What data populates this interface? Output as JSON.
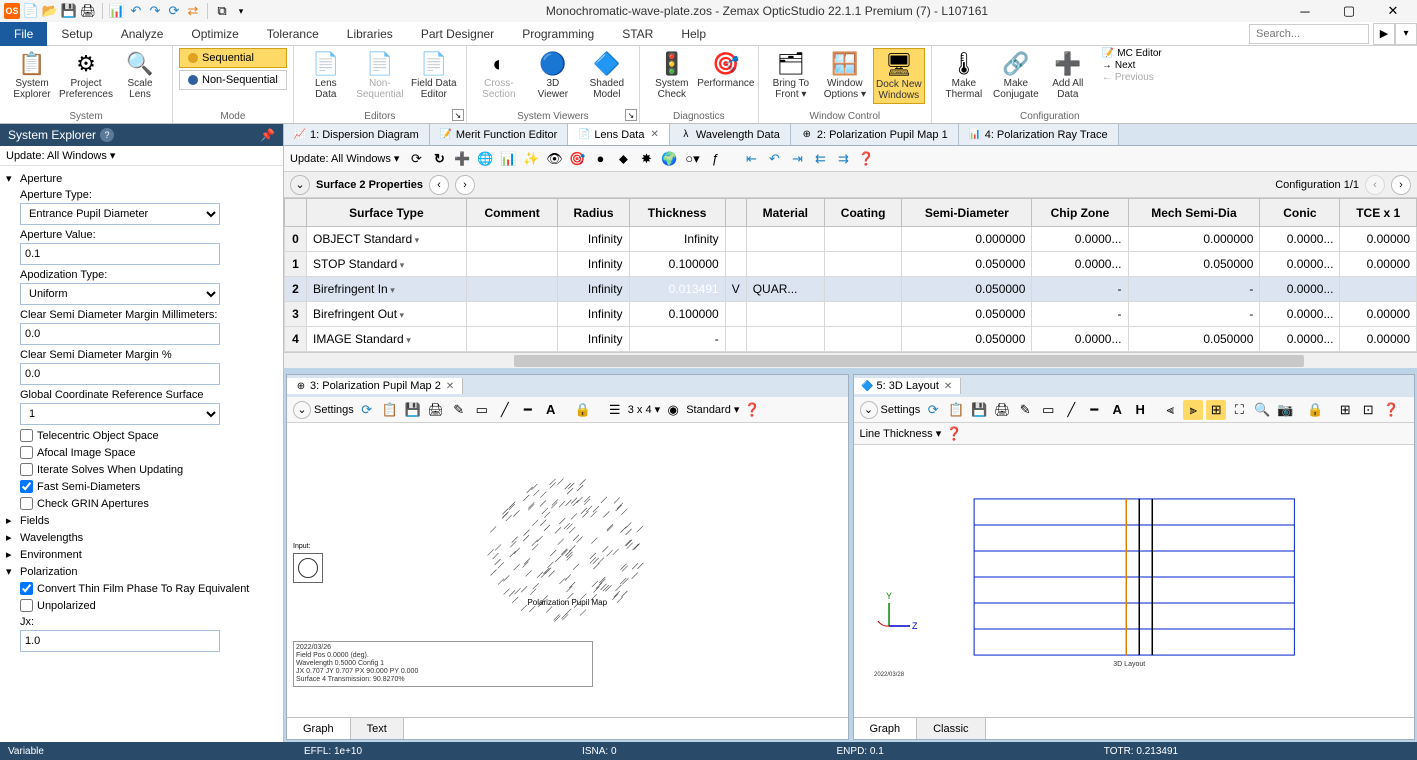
{
  "title": "Monochromatic-wave-plate.zos - Zemax OpticStudio 22.1.1  Premium (7) - L107161",
  "menu": [
    "Setup",
    "Analyze",
    "Optimize",
    "Tolerance",
    "Libraries",
    "Part Designer",
    "Programming",
    "STAR",
    "Help"
  ],
  "search_placeholder": "Search...",
  "ribbon": {
    "system": {
      "label": "System",
      "btns": [
        {
          "label": "System\nExplorer",
          "icon": "📋"
        },
        {
          "label": "Project\nPreferences",
          "icon": "⚙"
        },
        {
          "label": "Scale\nLens",
          "icon": "🔍"
        }
      ]
    },
    "mode": {
      "label": "Mode",
      "seq": "Sequential",
      "nonseq": "Non-Sequential"
    },
    "editors": {
      "label": "Editors",
      "btns": [
        {
          "label": "Lens\nData",
          "icon": "📄"
        },
        {
          "label": "Non-Sequential",
          "icon": "📄",
          "disabled": true
        },
        {
          "label": "Field Data\nEditor",
          "icon": "📄"
        }
      ]
    },
    "viewers": {
      "label": "System Viewers",
      "btns": [
        {
          "label": "Cross-Section",
          "icon": "◐",
          "disabled": true
        },
        {
          "label": "3D\nViewer",
          "icon": "🔵"
        },
        {
          "label": "Shaded\nModel",
          "icon": "🔷"
        }
      ]
    },
    "diag": {
      "label": "Diagnostics",
      "btns": [
        {
          "label": "System\nCheck",
          "icon": "🚦"
        },
        {
          "label": "Performance",
          "icon": "🎯"
        }
      ]
    },
    "windows": {
      "label": "Window Control",
      "btns": [
        {
          "label": "Bring To\nFront ▾",
          "icon": "🗂"
        },
        {
          "label": "Window\nOptions ▾",
          "icon": "🪟"
        },
        {
          "label": "Dock New\nWindows",
          "icon": "🖥",
          "active": true
        }
      ]
    },
    "config": {
      "label": "Configuration",
      "btns": [
        {
          "label": "Make\nThermal",
          "icon": "🌡"
        },
        {
          "label": "Make\nConjugate",
          "icon": "🔗"
        },
        {
          "label": "Add All\nData",
          "icon": "➕"
        }
      ],
      "side": [
        {
          "label": "MC Editor",
          "icon": "📝"
        },
        {
          "label": "Next",
          "icon": "→"
        },
        {
          "label": "Previous",
          "icon": "←",
          "disabled": true
        }
      ]
    }
  },
  "sidebar": {
    "title": "System Explorer",
    "update": "Update: All Windows ▾",
    "aperture": {
      "heading": "Aperture",
      "type_label": "Aperture Type:",
      "type_value": "Entrance Pupil Diameter",
      "value_label": "Aperture Value:",
      "value": "0.1",
      "apod_label": "Apodization Type:",
      "apod_value": "Uniform",
      "csdmm_label": "Clear Semi Diameter Margin Millimeters:",
      "csdmm_value": "0.0",
      "csdmp_label": "Clear Semi Diameter Margin %",
      "csdmp_value": "0.0",
      "gcrs_label": "Global Coordinate Reference Surface",
      "gcrs_value": "1",
      "checks": [
        {
          "label": "Telecentric Object Space",
          "checked": false
        },
        {
          "label": "Afocal Image Space",
          "checked": false
        },
        {
          "label": "Iterate Solves When Updating",
          "checked": false
        },
        {
          "label": "Fast Semi-Diameters",
          "checked": true
        },
        {
          "label": "Check GRIN Apertures",
          "checked": false
        }
      ]
    },
    "sections": [
      "Fields",
      "Wavelengths",
      "Environment",
      "Polarization"
    ],
    "polarization": {
      "checks": [
        {
          "label": "Convert Thin Film Phase To Ray Equivalent",
          "checked": true
        },
        {
          "label": "Unpolarized",
          "checked": false
        }
      ],
      "jx_label": "Jx:",
      "jx_value": "1.0"
    }
  },
  "tabs": [
    {
      "label": "1: Dispersion Diagram",
      "icon": "📈"
    },
    {
      "label": "Merit Function Editor",
      "icon": "📝"
    },
    {
      "label": "Lens Data",
      "icon": "📄",
      "active": true,
      "closable": true
    },
    {
      "label": "Wavelength Data",
      "icon": "λ"
    },
    {
      "label": "2: Polarization Pupil Map 1",
      "icon": "⊕"
    },
    {
      "label": "4: Polarization Ray Trace",
      "icon": "📊"
    }
  ],
  "lensdata": {
    "update": "Update: All Windows ▾",
    "surface_label": "Surface   2 Properties",
    "config_label": "Configuration 1/1",
    "headers": [
      "",
      "Surface Type",
      "Comment",
      "Radius",
      "Thickness",
      "",
      "Material",
      "Coating",
      "Semi-Diameter",
      "Chip Zone",
      "Mech Semi-Dia",
      "Conic",
      "TCE x 1"
    ],
    "rows": [
      {
        "n": "0",
        "name": "OBJECT",
        "type": "Standard",
        "radius": "Infinity",
        "thick": "Infinity",
        "mat": "",
        "coat": "",
        "semi": "0.000000",
        "chip": "0.0000...",
        "mech": "0.000000",
        "conic": "0.0000...",
        "tce": "0.00000"
      },
      {
        "n": "1",
        "name": "STOP",
        "type": "Standard",
        "radius": "Infinity",
        "thick": "0.100000",
        "mat": "",
        "coat": "",
        "semi": "0.050000",
        "chip": "0.0000...",
        "mech": "0.050000",
        "conic": "0.0000...",
        "tce": "0.00000"
      },
      {
        "n": "2",
        "name": "",
        "type": "Birefringent In",
        "radius": "Infinity",
        "thick": "0.013491",
        "thickflag": "V",
        "mat": "QUAR...",
        "coat": "",
        "semi": "0.050000",
        "chip": "-",
        "mech": "-",
        "conic": "0.0000...",
        "tce": "",
        "sel": true
      },
      {
        "n": "3",
        "name": "",
        "type": "Birefringent Out",
        "radius": "Infinity",
        "thick": "0.100000",
        "mat": "",
        "coat": "",
        "semi": "0.050000",
        "chip": "-",
        "mech": "-",
        "conic": "0.0000...",
        "tce": "0.00000"
      },
      {
        "n": "4",
        "name": "IMAGE",
        "type": "Standard",
        "radius": "Infinity",
        "thick": "-",
        "mat": "",
        "coat": "",
        "semi": "0.050000",
        "chip": "0.0000...",
        "mech": "0.050000",
        "conic": "0.0000...",
        "tce": "0.00000"
      }
    ]
  },
  "pupil": {
    "tab": "3: Polarization Pupil Map 2",
    "settings": "Settings",
    "sample": "3 x 4 ▾",
    "std": "Standard ▾",
    "title": "Polarization Pupil Map",
    "input_label": "Input:",
    "info": "2022/03/26\nField Pos         0.0000 (deg).\nWavelength   0.5000  Config  1\nJX  0.707  JY  0.707  PX  90.000  PY  0.000\nSurface 4 Transmission: 90.8270%",
    "footer": [
      "Graph",
      "Text"
    ]
  },
  "layout3d": {
    "tab": "5: 3D Layout",
    "settings": "Settings",
    "linethick": "Line Thickness ▾",
    "caption": "3D Layout",
    "date": "2022/03/28",
    "footer": [
      "Graph",
      "Classic"
    ]
  },
  "status": {
    "var": "Variable",
    "effl": "EFFL: 1e+10",
    "isna": "ISNA: 0",
    "enpd": "ENPD: 0.1",
    "totr": "TOTR: 0.213491"
  }
}
